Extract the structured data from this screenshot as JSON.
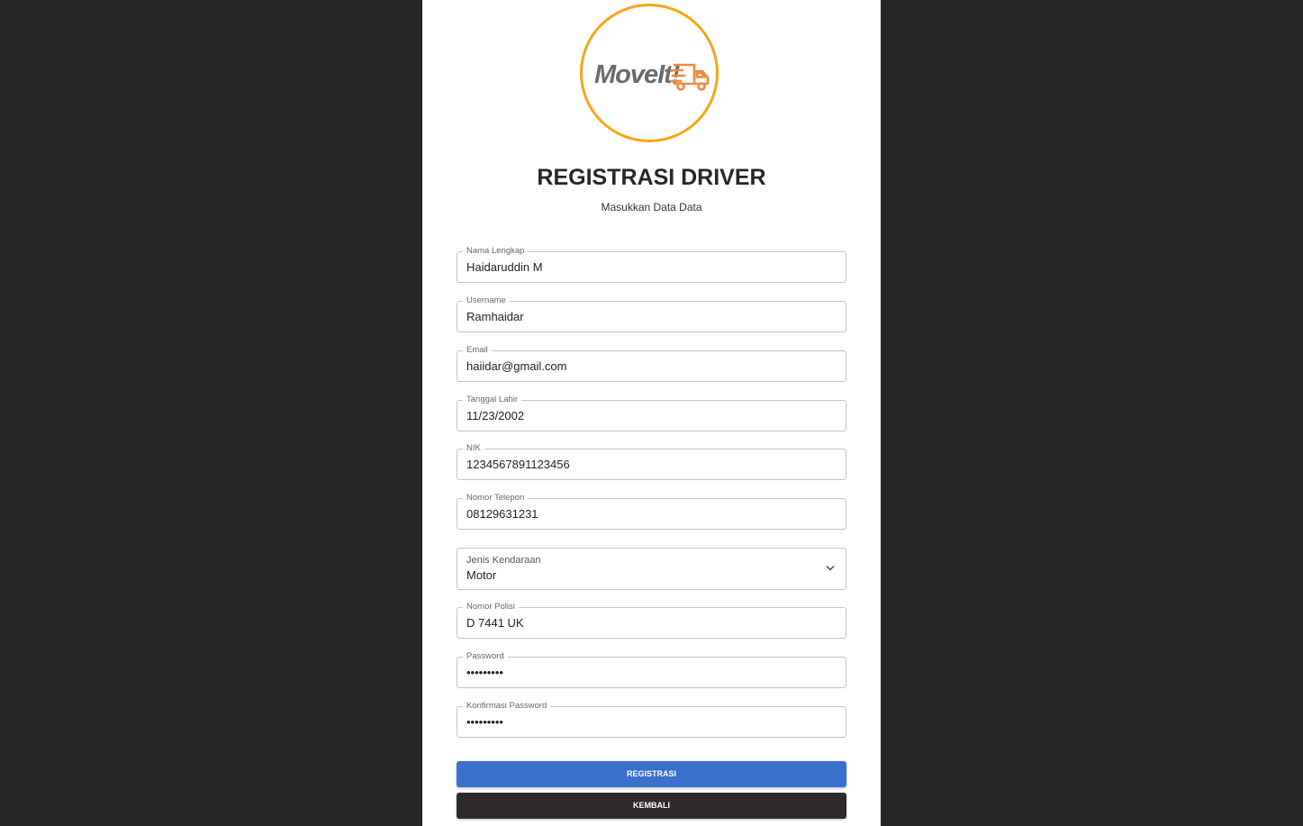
{
  "logo": {
    "text": "MoveIt!",
    "icon": "truck-icon",
    "ring_color": "#f9a51a",
    "icon_color": "#f08a3c"
  },
  "header": {
    "title": "REGISTRASI DRIVER",
    "subtitle": "Masukkan Data Data"
  },
  "form": {
    "nama": {
      "label": "Nama Lengkap",
      "value": "Haidaruddin M"
    },
    "username": {
      "label": "Username",
      "value": "Ramhaidar"
    },
    "email": {
      "label": "Email",
      "value": "haiidar@gmail.com"
    },
    "tanggal_lahir": {
      "label": "Tanggal Lahir",
      "value": "11/23/2002"
    },
    "nik": {
      "label": "NIK",
      "value": "1234567891123456"
    },
    "telepon": {
      "label": "Nomor Telepon",
      "value": "08129631231"
    },
    "kendaraan": {
      "label": "Jenis Kendaraan",
      "value": "Motor",
      "icon": "chevron-down-icon"
    },
    "polisi": {
      "label": "Nomor Polisi",
      "value": "D 7441 UK"
    },
    "password": {
      "label": "Password",
      "value": "•••••••••"
    },
    "konfirmasi": {
      "label": "Konfirmasi Password",
      "value": "•••••••••"
    }
  },
  "buttons": {
    "registrasi": "REGISTRASI",
    "kembali": "KEMBALI"
  },
  "colors": {
    "background": "#262626",
    "panel": "#ffffff",
    "primary_button": "#3a70cc",
    "secondary_button": "#2e2a2b"
  }
}
